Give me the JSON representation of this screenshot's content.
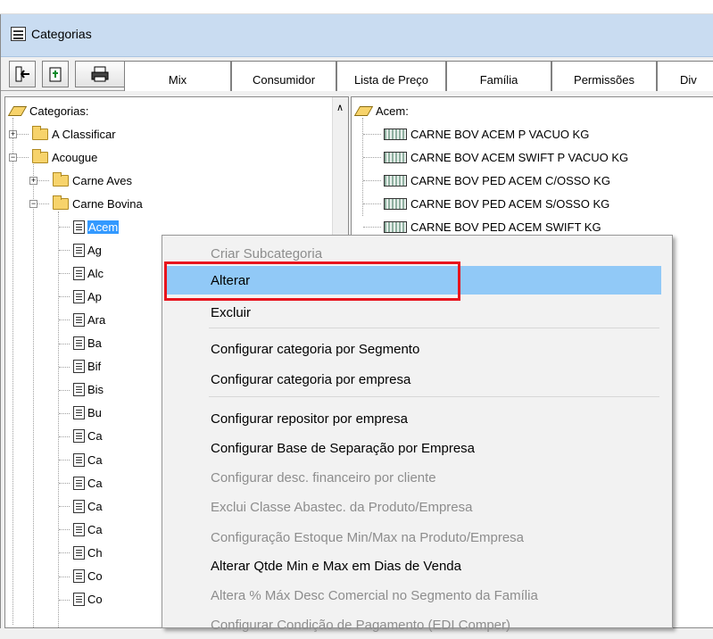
{
  "window": {
    "title": "Categorias"
  },
  "toolbar": {
    "tabs": [
      {
        "label": "Mix"
      },
      {
        "label": "Consumidor"
      },
      {
        "label": "Lista de Preço"
      },
      {
        "label": "Família"
      },
      {
        "label": "Permissões"
      },
      {
        "label": "Div"
      }
    ]
  },
  "tree": {
    "root": "Categorias:",
    "items": [
      {
        "label": "A Classificar"
      },
      {
        "label": "Acougue"
      },
      {
        "label": "Carne Aves"
      },
      {
        "label": "Carne Bovina"
      },
      {
        "label": "Acem"
      },
      {
        "label": "Ag"
      },
      {
        "label": "Alc"
      },
      {
        "label": "Ap"
      },
      {
        "label": "Ara"
      },
      {
        "label": "Ba"
      },
      {
        "label": "Bif"
      },
      {
        "label": "Bis"
      },
      {
        "label": "Bu"
      },
      {
        "label": "Ca"
      },
      {
        "label": "Ca"
      },
      {
        "label": "Ca"
      },
      {
        "label": "Ca"
      },
      {
        "label": "Ca"
      },
      {
        "label": "Ch"
      },
      {
        "label": "Co"
      },
      {
        "label": "Co"
      }
    ]
  },
  "products": {
    "header": "Acem:",
    "items": [
      "CARNE BOV ACEM P VACUO KG",
      "CARNE BOV ACEM SWIFT P VACUO KG",
      "CARNE BOV PED ACEM C/OSSO KG",
      "CARNE BOV PED ACEM S/OSSO KG",
      "CARNE BOV PED ACEM SWIFT KG"
    ]
  },
  "context_menu": {
    "items": [
      {
        "label": "Criar Subcategoria",
        "enabled": false
      },
      {
        "label": "Alterar",
        "enabled": true,
        "highlighted": true
      },
      {
        "label": "Excluir",
        "enabled": true
      },
      {
        "label": "Configurar categoria por Segmento",
        "enabled": true
      },
      {
        "label": "Configurar categoria por empresa",
        "enabled": true
      },
      {
        "label": "Configurar repositor por empresa",
        "enabled": true
      },
      {
        "label": "Configurar Base de Separação por Empresa",
        "enabled": true
      },
      {
        "label": "Configurar desc. financeiro por cliente",
        "enabled": false
      },
      {
        "label": "Exclui Classe Abastec. da Produto/Empresa",
        "enabled": false
      },
      {
        "label": "Configuração Estoque Min/Max na Produto/Empresa",
        "enabled": false
      },
      {
        "label": "Alterar Qtde Min e Max em Dias de Venda",
        "enabled": true
      },
      {
        "label": "Altera % Máx Desc Comercial no Segmento da Família",
        "enabled": false
      },
      {
        "label": "Configurar Condição de Pagamento (EDI Comper)",
        "enabled": false
      }
    ]
  },
  "colors": {
    "titlebar": "#c9dcf1",
    "selection": "#3399ff",
    "menu_hover": "#91c9f7",
    "annotation_red": "#e8141d"
  },
  "icons": [
    "exit-icon",
    "export-icon",
    "print-icon",
    "folder-icon",
    "document-icon",
    "product-icon"
  ]
}
